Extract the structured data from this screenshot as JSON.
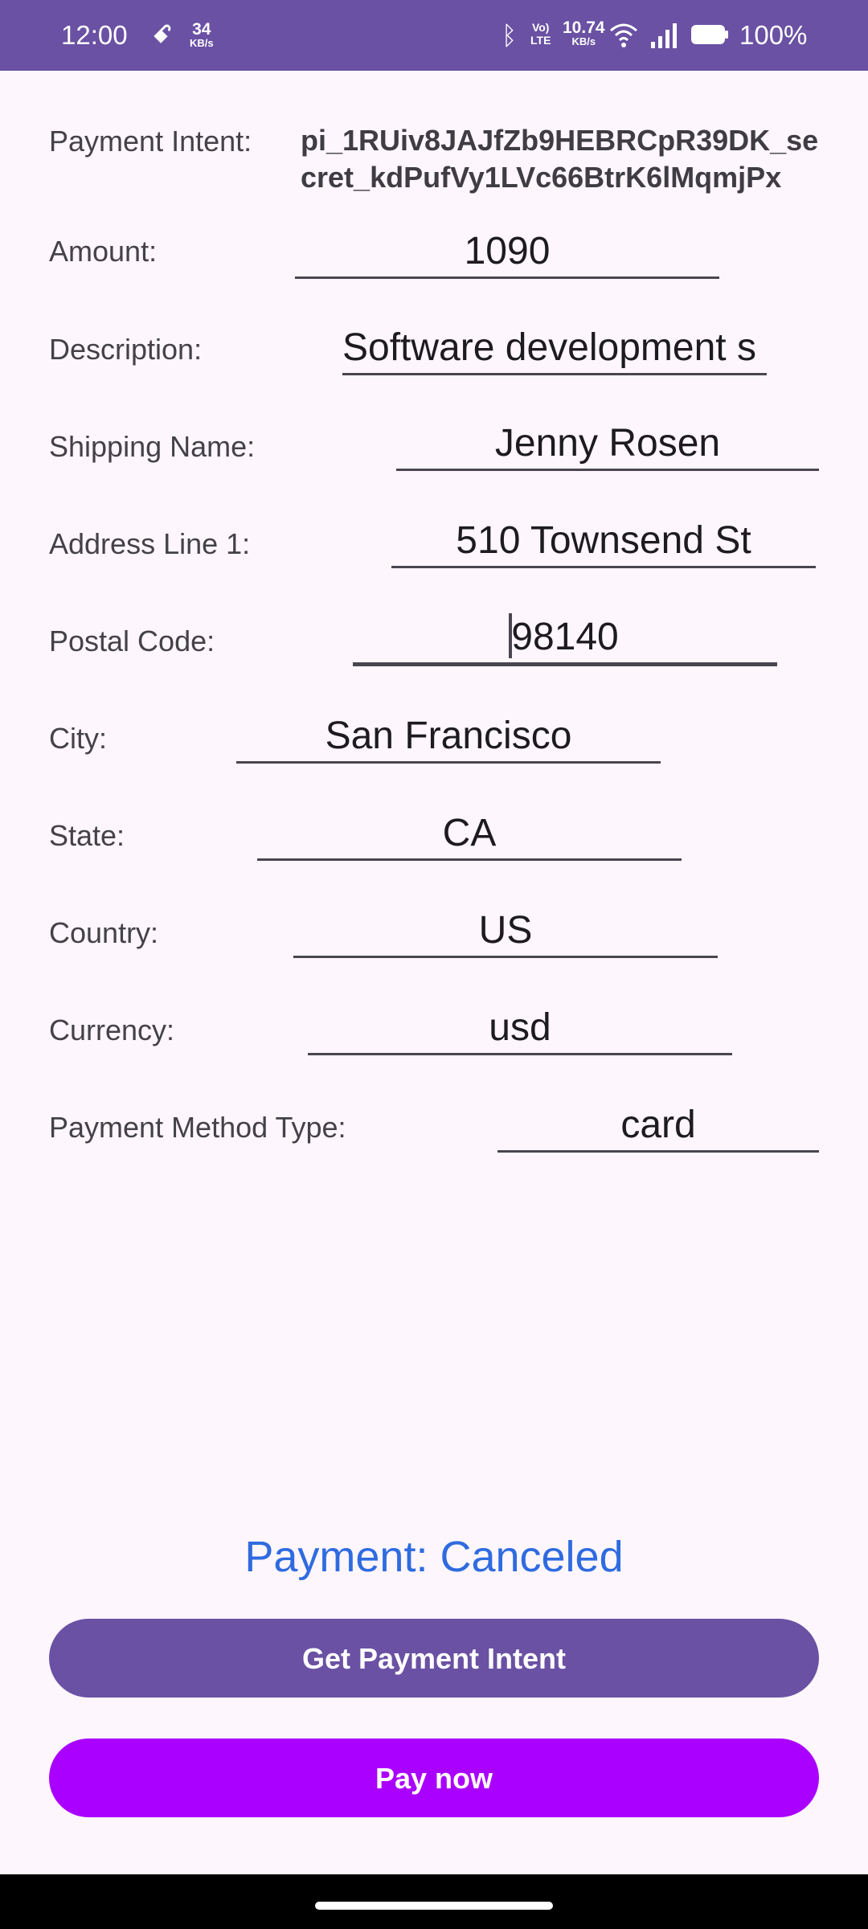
{
  "status_bar": {
    "time": "12:00",
    "left_speed_value": "34",
    "left_speed_unit": "KB/s",
    "volte_top": "Vo)",
    "volte_bottom": "LTE",
    "right_speed_value": "10.74",
    "right_speed_unit": "KB/s",
    "battery": "100%",
    "icons": [
      "notification-icon",
      "bluetooth-icon",
      "volte-icon",
      "wifi-icon",
      "signal-icon",
      "battery-icon"
    ]
  },
  "payment_intent": {
    "label": "Payment Intent:",
    "value": "pi_1RUiv8JAJfZb9HEBRCpR39DK_secret_kdPufVy1LVc66BtrK6lMqmjPx"
  },
  "fields": {
    "amount": {
      "label": "Amount:",
      "value": "1090"
    },
    "description": {
      "label": "Description:",
      "value": "Software development s"
    },
    "shipping_name": {
      "label": "Shipping Name:",
      "value": "Jenny Rosen"
    },
    "address_line1": {
      "label": "Address Line 1:",
      "value": "510 Townsend St"
    },
    "postal_code": {
      "label": "Postal Code:",
      "value": "98140"
    },
    "city": {
      "label": "City:",
      "value": "San Francisco"
    },
    "state": {
      "label": "State:",
      "value": "CA"
    },
    "country": {
      "label": "Country:",
      "value": "US"
    },
    "currency": {
      "label": "Currency:",
      "value": "usd"
    },
    "payment_method_type": {
      "label": "Payment Method Type:",
      "value": "card"
    }
  },
  "payment_status": "Payment: Canceled",
  "buttons": {
    "get_intent": "Get Payment Intent",
    "pay_now": "Pay now"
  },
  "colors": {
    "status_bar": "#6a51a3",
    "primary_button": "#6a51a3",
    "pay_button": "#aa00ff",
    "status_text": "#2f6be0",
    "background": "#fdf6fc"
  }
}
